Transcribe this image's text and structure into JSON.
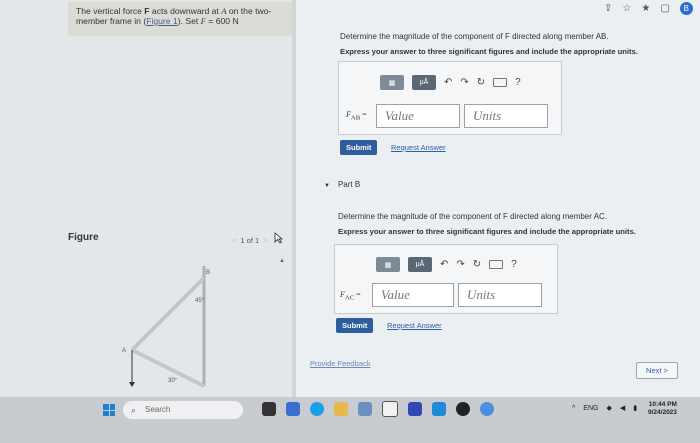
{
  "problem": {
    "text_before": "The vertical force ",
    "force": "F",
    "text_mid1": " acts downward at ",
    "point": "A",
    "text_mid2": " on the two-member frame in (",
    "figure_link": "Figure 1",
    "text_end": "). Set ",
    "force_eq": "F",
    "value": " = 600 N"
  },
  "figure": {
    "label": "Figure",
    "pager": "1 of 1",
    "point_labels": {
      "A": "A",
      "B": "B"
    },
    "angles": {
      "top": "45°",
      "bottom": "30°"
    }
  },
  "partA": {
    "prompt": "Determine the magnitude of the component of F directed along member AB.",
    "instructions": "Express your answer to three significant figures and include the appropriate units.",
    "var_label": "F",
    "var_sub": "AB",
    "value_placeholder": "Value",
    "units_placeholder": "Units",
    "submit": "Submit",
    "request": "Request Answer"
  },
  "partB": {
    "title": "Part B",
    "prompt": "Determine the magnitude of the component of F directed along member AC.",
    "instructions": "Express your answer to three significant figures and include the appropriate units.",
    "var_label": "F",
    "var_sub": "AC",
    "value_placeholder": "Value",
    "units_placeholder": "Units",
    "submit": "Submit",
    "request": "Request Answer"
  },
  "toolbar": {
    "matrix": "▦",
    "mu": "μÅ",
    "help": "?"
  },
  "feedback": "Provide Feedback",
  "next": "Next >",
  "taskbar": {
    "search": "Search",
    "lang": "ENG",
    "time": "10:44 PM",
    "date": "9/24/2023"
  },
  "colors": {
    "accent": "#2d5d9b",
    "windows": "#1d7fd6"
  }
}
